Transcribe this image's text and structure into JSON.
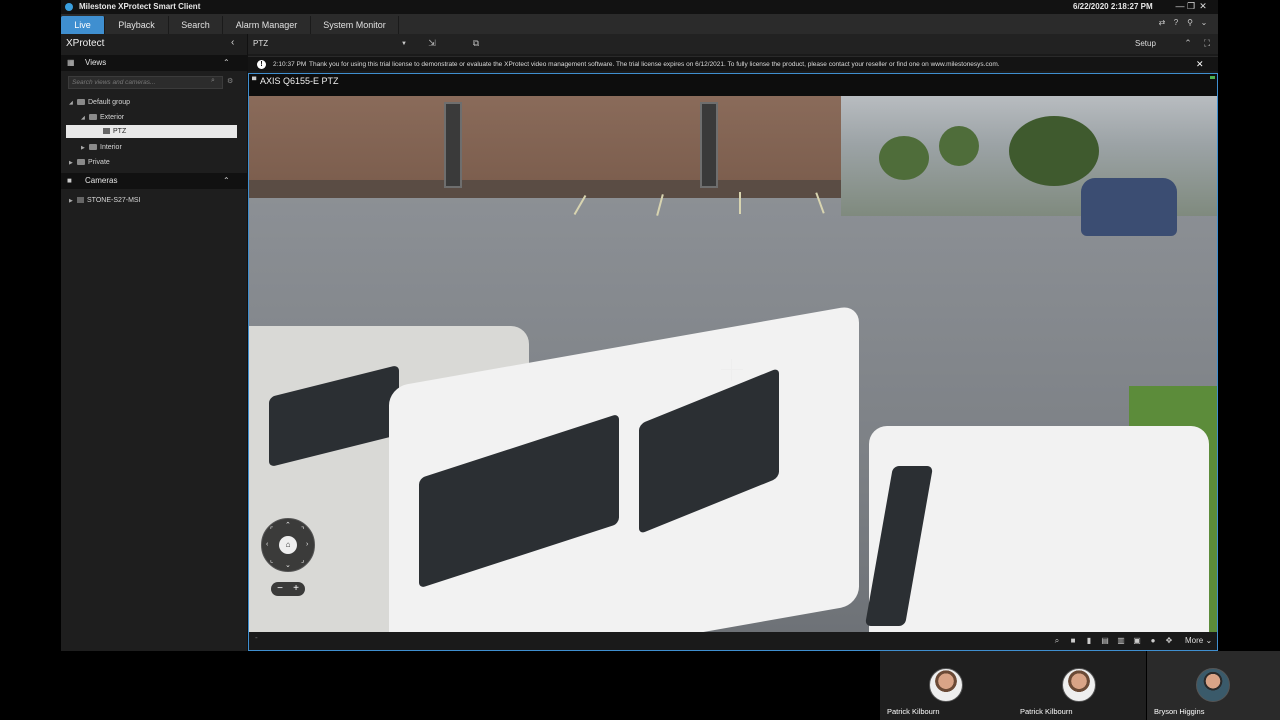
{
  "window": {
    "title": "Milestone XProtect Smart Client",
    "datetime": "6/22/2020 2:18:27 PM",
    "controls": [
      "minimize-icon",
      "restore-icon",
      "close-icon"
    ]
  },
  "nav": {
    "tabs": [
      {
        "label": "Live",
        "active": true
      },
      {
        "label": "Playback",
        "active": false
      },
      {
        "label": "Search",
        "active": false
      },
      {
        "label": "Alarm Manager",
        "active": false
      },
      {
        "label": "System Monitor",
        "active": false
      }
    ],
    "icons": [
      "network-icon",
      "help-icon",
      "pin-icon",
      "chevron-down-icon"
    ]
  },
  "sidebar": {
    "title": "XProtect",
    "views": {
      "label": "Views",
      "search_placeholder": "Search views and cameras...",
      "tree": [
        {
          "label": "Default group",
          "level": 0,
          "expanded": true
        },
        {
          "label": "Exterior",
          "level": 1,
          "expanded": true
        },
        {
          "label": "PTZ",
          "level": 2,
          "selected": true
        },
        {
          "label": "Interior",
          "level": 1,
          "expanded": false
        },
        {
          "label": "Private",
          "level": 0,
          "expanded": false
        }
      ]
    },
    "cameras": {
      "label": "Cameras",
      "tree": [
        {
          "label": "STONE-S27-MSI",
          "level": 0,
          "expanded": false
        }
      ]
    }
  },
  "toolbar": {
    "view_name": "PTZ",
    "setup_label": "Setup"
  },
  "notice": {
    "time": "2:10:37 PM",
    "text": "Thank you for using this trial license to demonstrate or evaluate the XProtect video management software. The trial license expires on 6/12/2021. To fully license the product, please contact your reseller or find one on www.milestonesys.com."
  },
  "camera_tile": {
    "name": "AXIS Q6155-E PTZ",
    "zoom_minus": "−",
    "zoom_plus": "+",
    "footer_tick": "-",
    "more_label": "More"
  },
  "participants": [
    {
      "name": "Patrick Kilbourn",
      "active": false
    },
    {
      "name": "Patrick Kilbourn",
      "active": false
    },
    {
      "name": "Bryson Higgins",
      "active": true
    }
  ],
  "colors": {
    "accent": "#3f8fd0",
    "background": "#1b1b1b"
  }
}
